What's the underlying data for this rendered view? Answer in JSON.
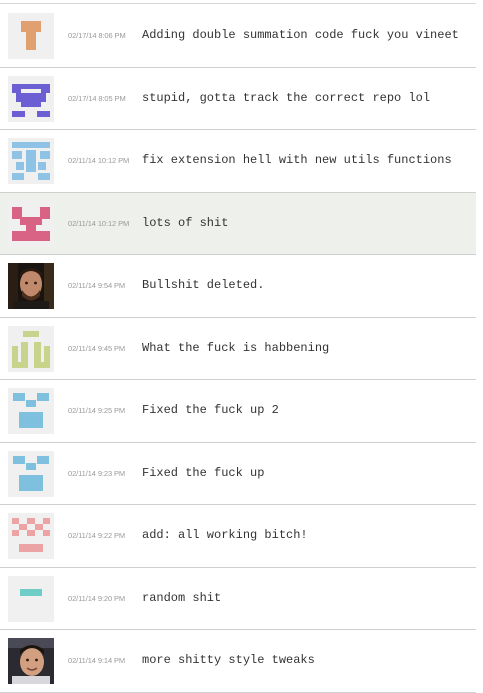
{
  "commits": [
    {
      "timestamp": "02/17/14 8:06 PM",
      "message": "Adding double summation code fuck you vineet",
      "avatar_icon": "identicon-orange-t",
      "color": "#e0a070"
    },
    {
      "timestamp": "02/17/14 8:05 PM",
      "message": "stupid, gotta track the correct repo lol",
      "avatar_icon": "identicon-purple",
      "color": "#6b5fd3"
    },
    {
      "timestamp": "02/11/14 10:12 PM",
      "message": "fix extension hell with new utils functions",
      "avatar_icon": "identicon-light-blue",
      "color": "#8ec3e6"
    },
    {
      "timestamp": "02/11/14 10:12 PM",
      "message": "lots of shit",
      "avatar_icon": "identicon-pink",
      "color": "#d96384"
    },
    {
      "timestamp": "02/11/14 9:54 PM",
      "message": "Bullshit deleted.",
      "avatar_icon": "user-photo-icon"
    },
    {
      "timestamp": "02/11/14 9:45 PM",
      "message": "What the fuck is habbening",
      "avatar_icon": "identicon-olive",
      "color": "#c8d48c"
    },
    {
      "timestamp": "02/11/14 9:25 PM",
      "message": "Fixed the fuck up 2",
      "avatar_icon": "identicon-blue",
      "color": "#7ec0dd"
    },
    {
      "timestamp": "02/11/14 9:23 PM",
      "message": "Fixed the fuck up",
      "avatar_icon": "identicon-blue",
      "color": "#7ec0dd"
    },
    {
      "timestamp": "02/11/14 9:22 PM",
      "message": "add: all working bitch!",
      "avatar_icon": "identicon-salmon",
      "color": "#eba3a3"
    },
    {
      "timestamp": "02/11/14 9:20 PM",
      "message": "random shit",
      "avatar_icon": "identicon-teal",
      "color": "#6fcdc8"
    },
    {
      "timestamp": "02/11/14 9:14 PM",
      "message": "more shitty style tweaks",
      "avatar_icon": "user-photo-icon"
    }
  ]
}
